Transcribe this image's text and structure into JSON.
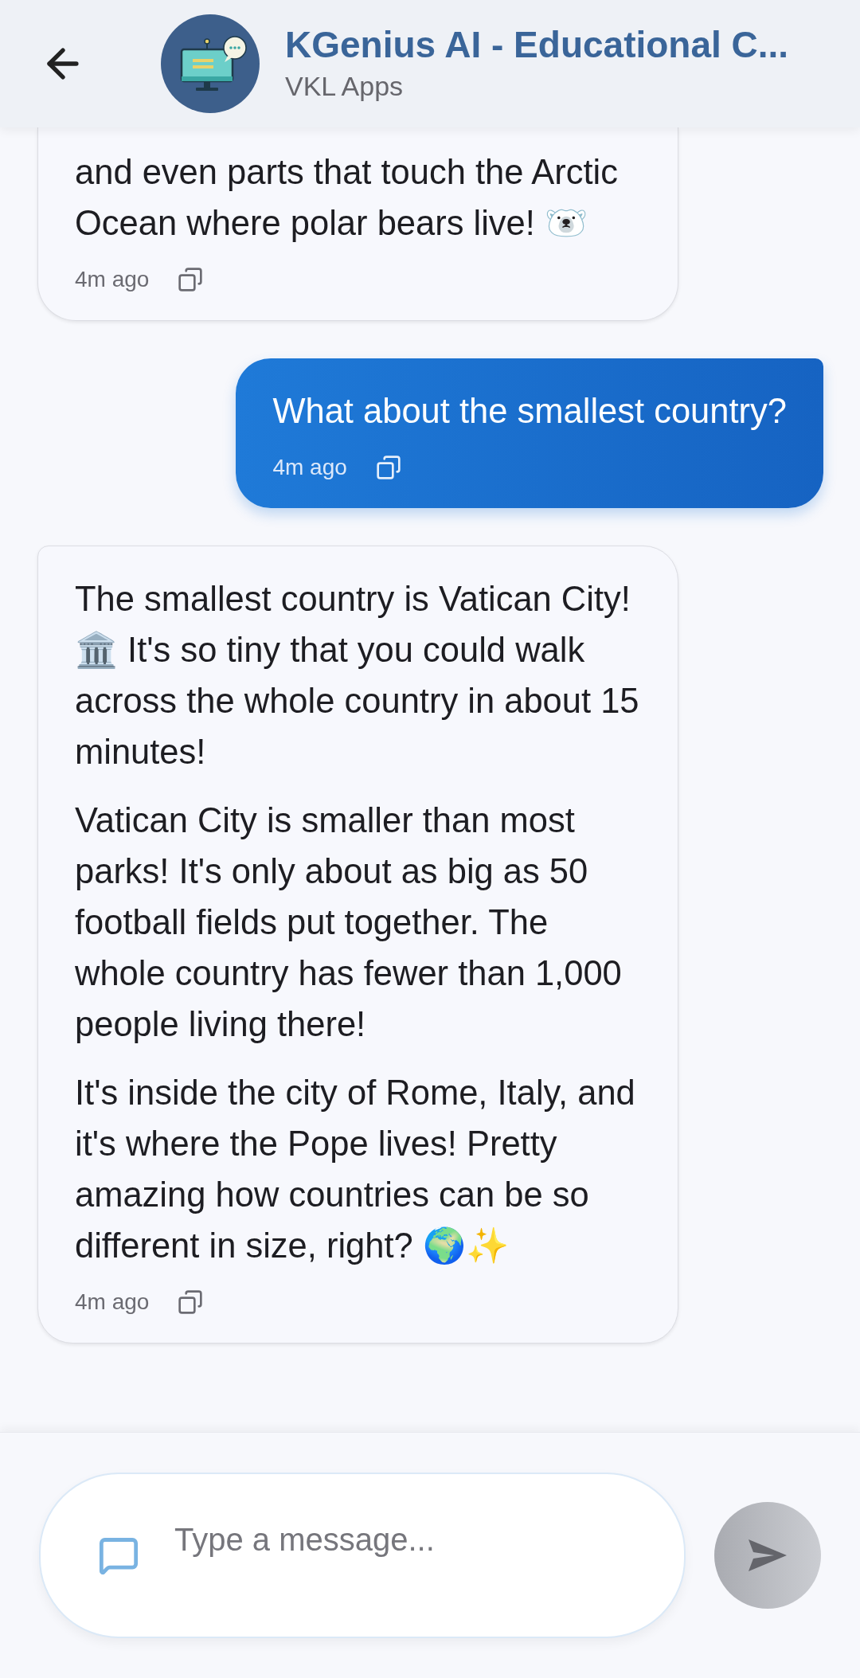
{
  "header": {
    "title": "KGenius AI - Educational C...",
    "subtitle": "VKL Apps"
  },
  "messages": [
    {
      "kind": "bot",
      "cut_top": true,
      "paragraphs": [
        "and even parts that touch the Arctic Ocean where polar bears live! 🐻‍❄️"
      ],
      "time": "4m ago"
    },
    {
      "kind": "user",
      "cut_top": false,
      "paragraphs": [
        "What about the smallest country?"
      ],
      "time": "4m ago"
    },
    {
      "kind": "bot",
      "cut_top": false,
      "paragraphs": [
        "The smallest country is Vatican City! 🏛️ It's so tiny that you could walk across the whole country in about 15 minutes!",
        "Vatican City is smaller than most parks! It's only about as big as 50 football fields put together. The whole country has fewer than 1,000 people living there!",
        "It's inside the city of Rome, Italy, and it's where the Pope lives! Pretty amazing how countries can be so different in size, right? 🌍✨"
      ],
      "time": "4m ago"
    }
  ],
  "composer": {
    "placeholder": "Type a message..."
  }
}
